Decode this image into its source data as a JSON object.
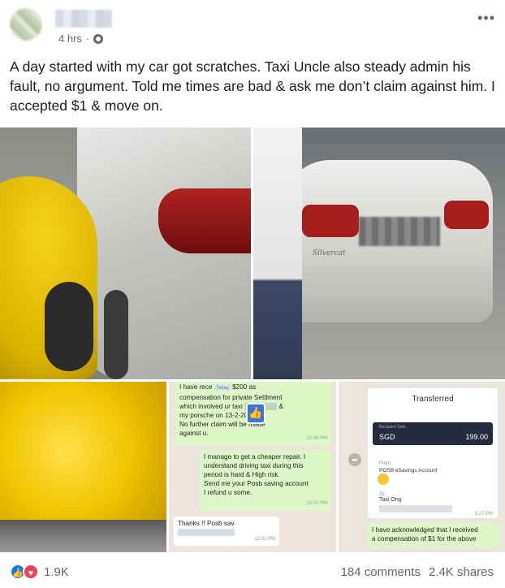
{
  "post": {
    "time": "4 hrs",
    "more_label": "•••",
    "text": "A day started with my car got scratches. Taxi Uncle also steady admin his fault, no argument. Told me times are bad & ask me don’t claim against him. I accepted $1 & move on."
  },
  "photos": {
    "taxi_text": "Silvercat",
    "chat1": {
      "msg1_l1": "I have rece",
      "msg1_tag": "Today",
      "msg1_rest": "$200 as",
      "msg1_l2": "compensation for private Settlment",
      "msg1_l3": "which involved ur taxi",
      "msg1_l3b": "&",
      "msg1_l4": "my porsche",
      "msg1_l4b": "on 13-2-2020.",
      "msg1_l5": "No further claim will be made",
      "msg1_l6": "against u.",
      "msg1_time": "12:49 PM",
      "msg2_l1": "I manage to get a cheaper repair. I",
      "msg2_l2": "understand driving taxi during this",
      "msg2_l3": "period is hard & High risk.",
      "msg2_l4": "Send me your Posb saving account",
      "msg2_l5": "I refund u some.",
      "msg2_time": "12:53 PM",
      "msg3": "Thanks !! Posb sav.",
      "msg3_time": "12:51 PM"
    },
    "chat2": {
      "title": "Transferred",
      "recipient_label": "Recipient Gets",
      "currency": "SGD",
      "amount": "199.00",
      "from_label": "From",
      "from_account": "POSB eSavings Account",
      "to_label": "To",
      "to_name": "Taxi Ong",
      "time": "1:27 PM",
      "ack_l1": "I have acknowledged that I received",
      "ack_l2": "a compensation of $1 for the above"
    }
  },
  "footer": {
    "reaction_count": "1.9K",
    "comments": "184 comments",
    "shares": "2.4K shares"
  },
  "colors": {
    "like": "#1877f2",
    "love": "#f33e58",
    "chat_bubble": "#dcf8c6"
  }
}
